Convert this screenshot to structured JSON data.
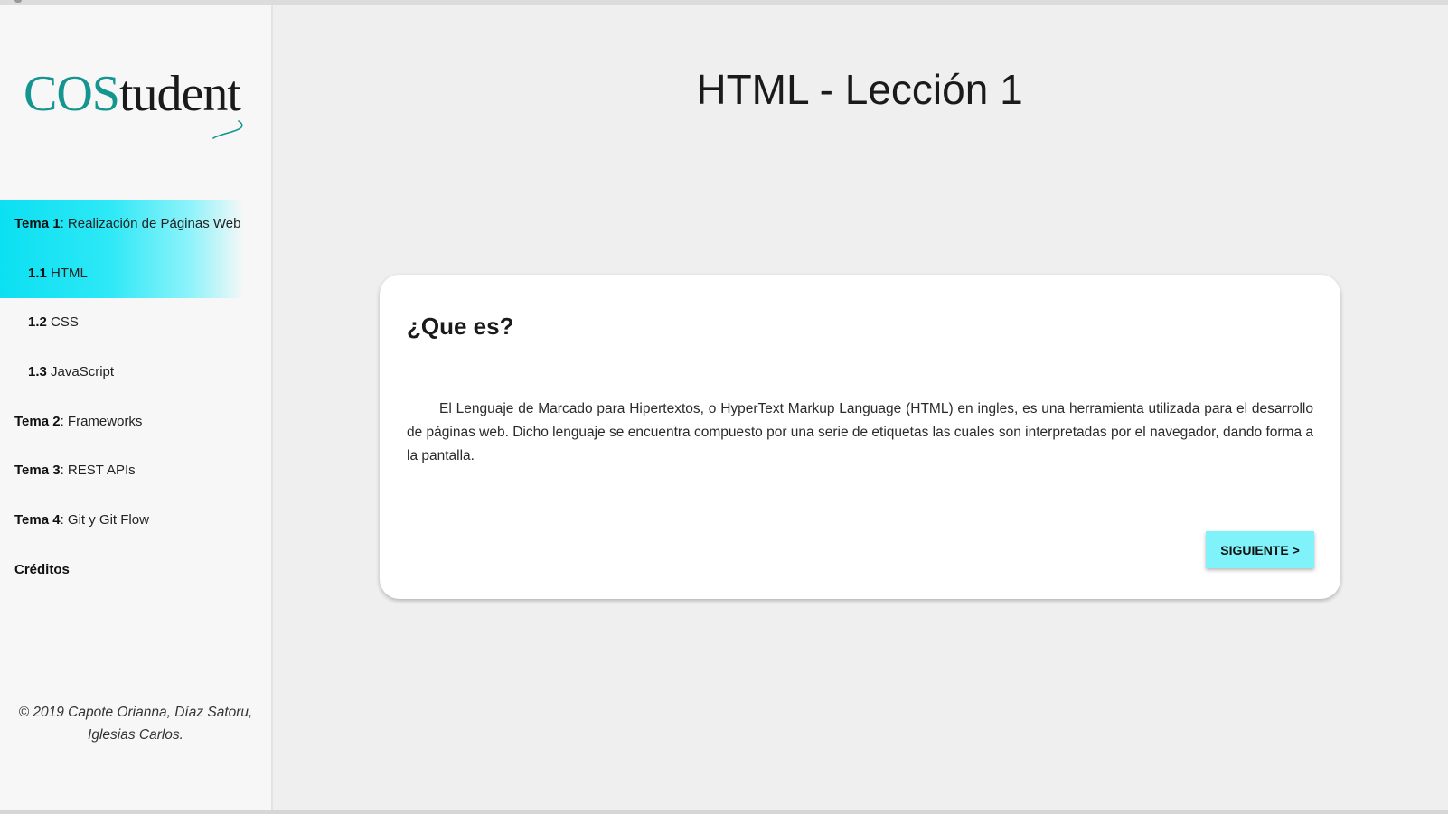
{
  "sidebar": {
    "logo": {
      "prefix": "COS",
      "suffix": "tudent",
      "colors": {
        "prefix": "#14958f",
        "suffix": "#1a1a1a"
      }
    },
    "nav": [
      {
        "bold": "Tema 1",
        "rest": ": Realización de Páginas Web",
        "active": true
      },
      {
        "bold": "1.1",
        "rest": " HTML",
        "active": true
      },
      {
        "bold": "1.2",
        "rest": " CSS",
        "active": false
      },
      {
        "bold": "1.3",
        "rest": " JavaScript",
        "active": false
      },
      {
        "bold": "Tema 2",
        "rest": ": Frameworks",
        "active": false
      },
      {
        "bold": "Tema 3",
        "rest": ": REST APIs",
        "active": false
      },
      {
        "bold": "Tema 4",
        "rest": ": Git y Git Flow",
        "active": false
      },
      {
        "bold": "Créditos",
        "rest": "",
        "active": false
      }
    ],
    "footer": {
      "line1": "© 2019 Capote Orianna, Díaz Satoru,",
      "line2": "Iglesias Carlos."
    }
  },
  "main": {
    "title": "HTML - Lección 1",
    "card": {
      "heading": "¿Que es?",
      "body": "El Lenguaje de Marcado para Hipertextos, o HyperText Markup Language (HTML) en ingles, es una herramienta utilizada para el desarrollo de páginas web. Dicho lenguaje se encuentra compuesto por una serie de etiquetas las cuales son interpretadas por el navegador, dando forma a la pantalla.",
      "next_button": "SIGUIENTE >"
    }
  },
  "colors": {
    "accent": "#0be0f2",
    "button": "#7ff3f9",
    "background": "#efefef"
  }
}
